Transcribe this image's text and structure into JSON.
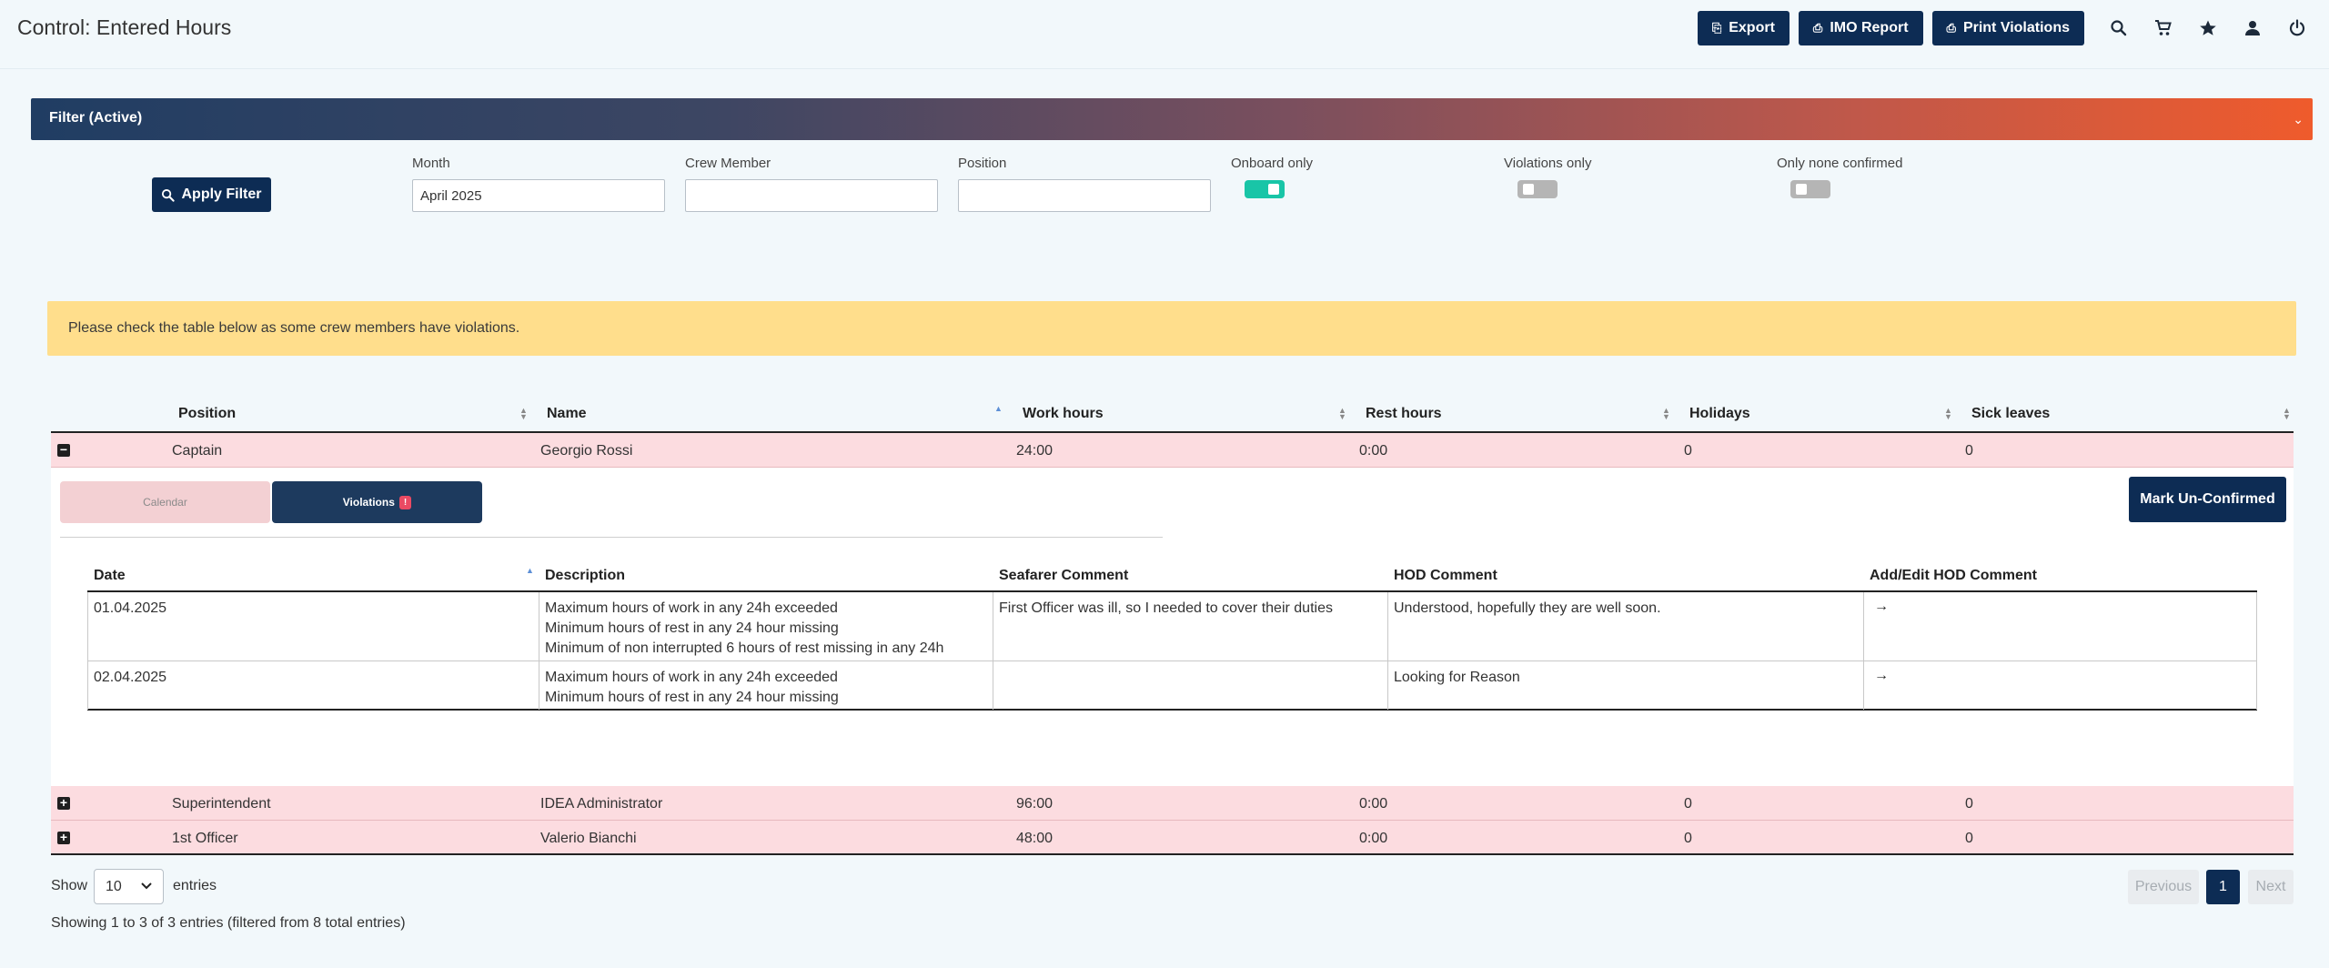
{
  "header": {
    "title": "Control: Entered Hours",
    "export_label": "Export",
    "imo_report_label": "IMO Report",
    "print_violations_label": "Print Violations"
  },
  "filter": {
    "title": "Filter  (Active)",
    "apply_label": "Apply Filter",
    "month_label": "Month",
    "month_value": "April 2025",
    "crew_member_label": "Crew Member",
    "crew_member_value": "",
    "position_label": "Position",
    "position_value": "",
    "onboard_only_label": "Onboard only",
    "onboard_only": true,
    "violations_only_label": "Violations only",
    "violations_only": false,
    "only_none_confirmed_label": "Only none confirmed",
    "only_none_confirmed": false
  },
  "alert": {
    "message": "Please check the table below as some crew members have violations."
  },
  "table": {
    "columns": [
      "Position",
      "Name",
      "Work hours",
      "Rest hours",
      "Holidays",
      "Sick leaves"
    ],
    "rows": [
      {
        "expander": "−",
        "position": "Captain",
        "name": "Georgio Rossi",
        "work_hours": "24:00",
        "rest_hours": "0:00",
        "holidays": "0",
        "sick_leaves": "0"
      },
      {
        "expander": "+",
        "position": "Superintendent",
        "name": "IDEA Administrator",
        "work_hours": "96:00",
        "rest_hours": "0:00",
        "holidays": "0",
        "sick_leaves": "0"
      },
      {
        "expander": "+",
        "position": "1st Officer",
        "name": "Valerio Bianchi",
        "work_hours": "48:00",
        "rest_hours": "0:00",
        "holidays": "0",
        "sick_leaves": "0"
      }
    ]
  },
  "detail": {
    "tab_calendar": "Calendar",
    "tab_violations": "Violations",
    "violations_badge": "!",
    "mark_unconfirmed_label": "Mark Un-Confirmed",
    "columns": [
      "Date",
      "Description",
      "Seafarer Comment",
      "HOD Comment",
      "Add/Edit HOD Comment"
    ],
    "rows": [
      {
        "date": "01.04.2025",
        "description": [
          "Maximum hours of work in any 24h exceeded",
          "Minimum hours of rest in any 24 hour missing",
          "Minimum of non interrupted 6 hours of rest missing in any 24h"
        ],
        "seafarer_comment": "First Officer was ill, so I needed to cover their duties",
        "hod_comment": "Understood, hopefully they are well soon.",
        "action_icon": "→"
      },
      {
        "date": "02.04.2025",
        "description": [
          "Maximum hours of work in any 24h exceeded",
          "Minimum hours of rest in any 24 hour missing"
        ],
        "seafarer_comment": "",
        "hod_comment": "Looking for Reason",
        "action_icon": "→"
      }
    ]
  },
  "footer": {
    "show_label": "Show",
    "page_size": "10",
    "entries_label": "entries",
    "info": "Showing 1 to 3 of 3 entries (filtered from 8 total entries)",
    "previous_label": "Previous",
    "current_page": "1",
    "next_label": "Next"
  },
  "colors": {
    "primary": "#0d2c54",
    "toggle_on": "#19c5a7",
    "alert_bg": "#ffde8c",
    "row_highlight": "#fcdce0",
    "badge": "#ea4a63"
  }
}
